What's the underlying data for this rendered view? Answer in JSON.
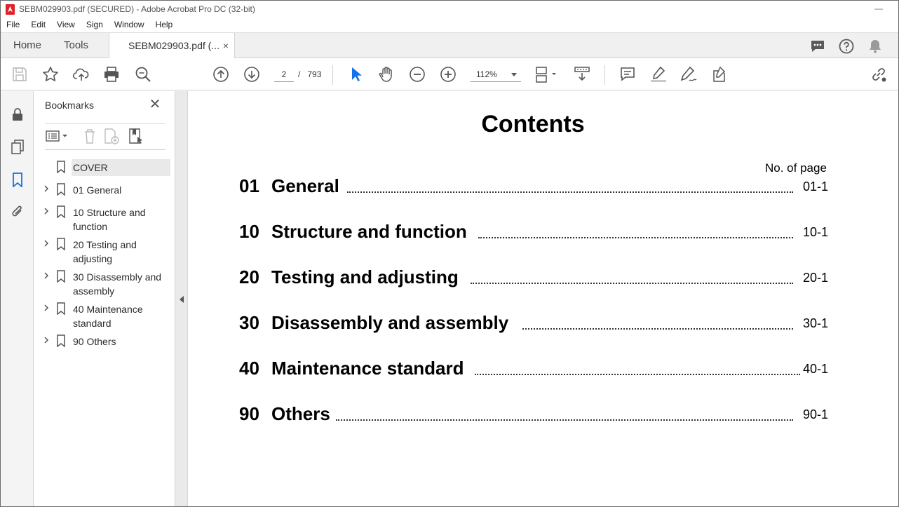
{
  "window": {
    "title": "SEBM029903.pdf (SECURED) - Adobe Acrobat Pro DC (32-bit)",
    "minimize": "—"
  },
  "menu": [
    "File",
    "Edit",
    "View",
    "Sign",
    "Window",
    "Help"
  ],
  "tabs": {
    "home": "Home",
    "tools": "Tools",
    "document": "SEBM029903.pdf (...",
    "close": "×"
  },
  "toolbar": {
    "current_page": "2",
    "page_separator": "/",
    "total_pages": "793",
    "zoom": "112%"
  },
  "bookmarks": {
    "title": "Bookmarks",
    "close": "✕",
    "items": [
      {
        "label": "COVER",
        "expandable": false,
        "selected": true
      },
      {
        "label": "01 General",
        "expandable": true
      },
      {
        "label": "10 Structure and function",
        "expandable": true
      },
      {
        "label": "20 Testing and adjusting",
        "expandable": true
      },
      {
        "label": "30 Disassembly and assembly",
        "expandable": true
      },
      {
        "label": "40 Maintenance standard",
        "expandable": true
      },
      {
        "label": "90 Others",
        "expandable": true
      }
    ]
  },
  "document": {
    "heading": "Contents",
    "page_col_header": "No. of page",
    "toc": [
      {
        "num": "01",
        "title": "General",
        "page": "01-1"
      },
      {
        "num": "10",
        "title": "Structure and function",
        "page": "10-1"
      },
      {
        "num": "20",
        "title": "Testing and adjusting",
        "page": "20-1"
      },
      {
        "num": "30",
        "title": "Disassembly and assembly",
        "page": "30-1"
      },
      {
        "num": "40",
        "title": "Maintenance standard",
        "page": "40-1"
      },
      {
        "num": "90",
        "title": "Others",
        "page": "90-1"
      }
    ]
  },
  "icons": {
    "toolbar": [
      "save-icon",
      "bookmark-star-icon",
      "upload-cloud-icon",
      "print-icon",
      "search-zoom-icon",
      "prev-page-icon",
      "next-page-icon",
      "select-cursor-icon",
      "hand-icon",
      "zoom-out-icon",
      "zoom-in-icon",
      "page-display-icon",
      "scroll-mode-icon",
      "comment-icon",
      "highlight-icon",
      "draw-icon",
      "edit-stamp-icon",
      "share-link-icon"
    ],
    "rail": [
      "lock-icon",
      "pages-icon",
      "bookmark-icon",
      "attachment-icon"
    ],
    "topright": [
      "chat-icon",
      "help-icon",
      "bell-icon"
    ]
  },
  "colors": {
    "accent": "#1473e6",
    "brand": "#e21f26"
  }
}
